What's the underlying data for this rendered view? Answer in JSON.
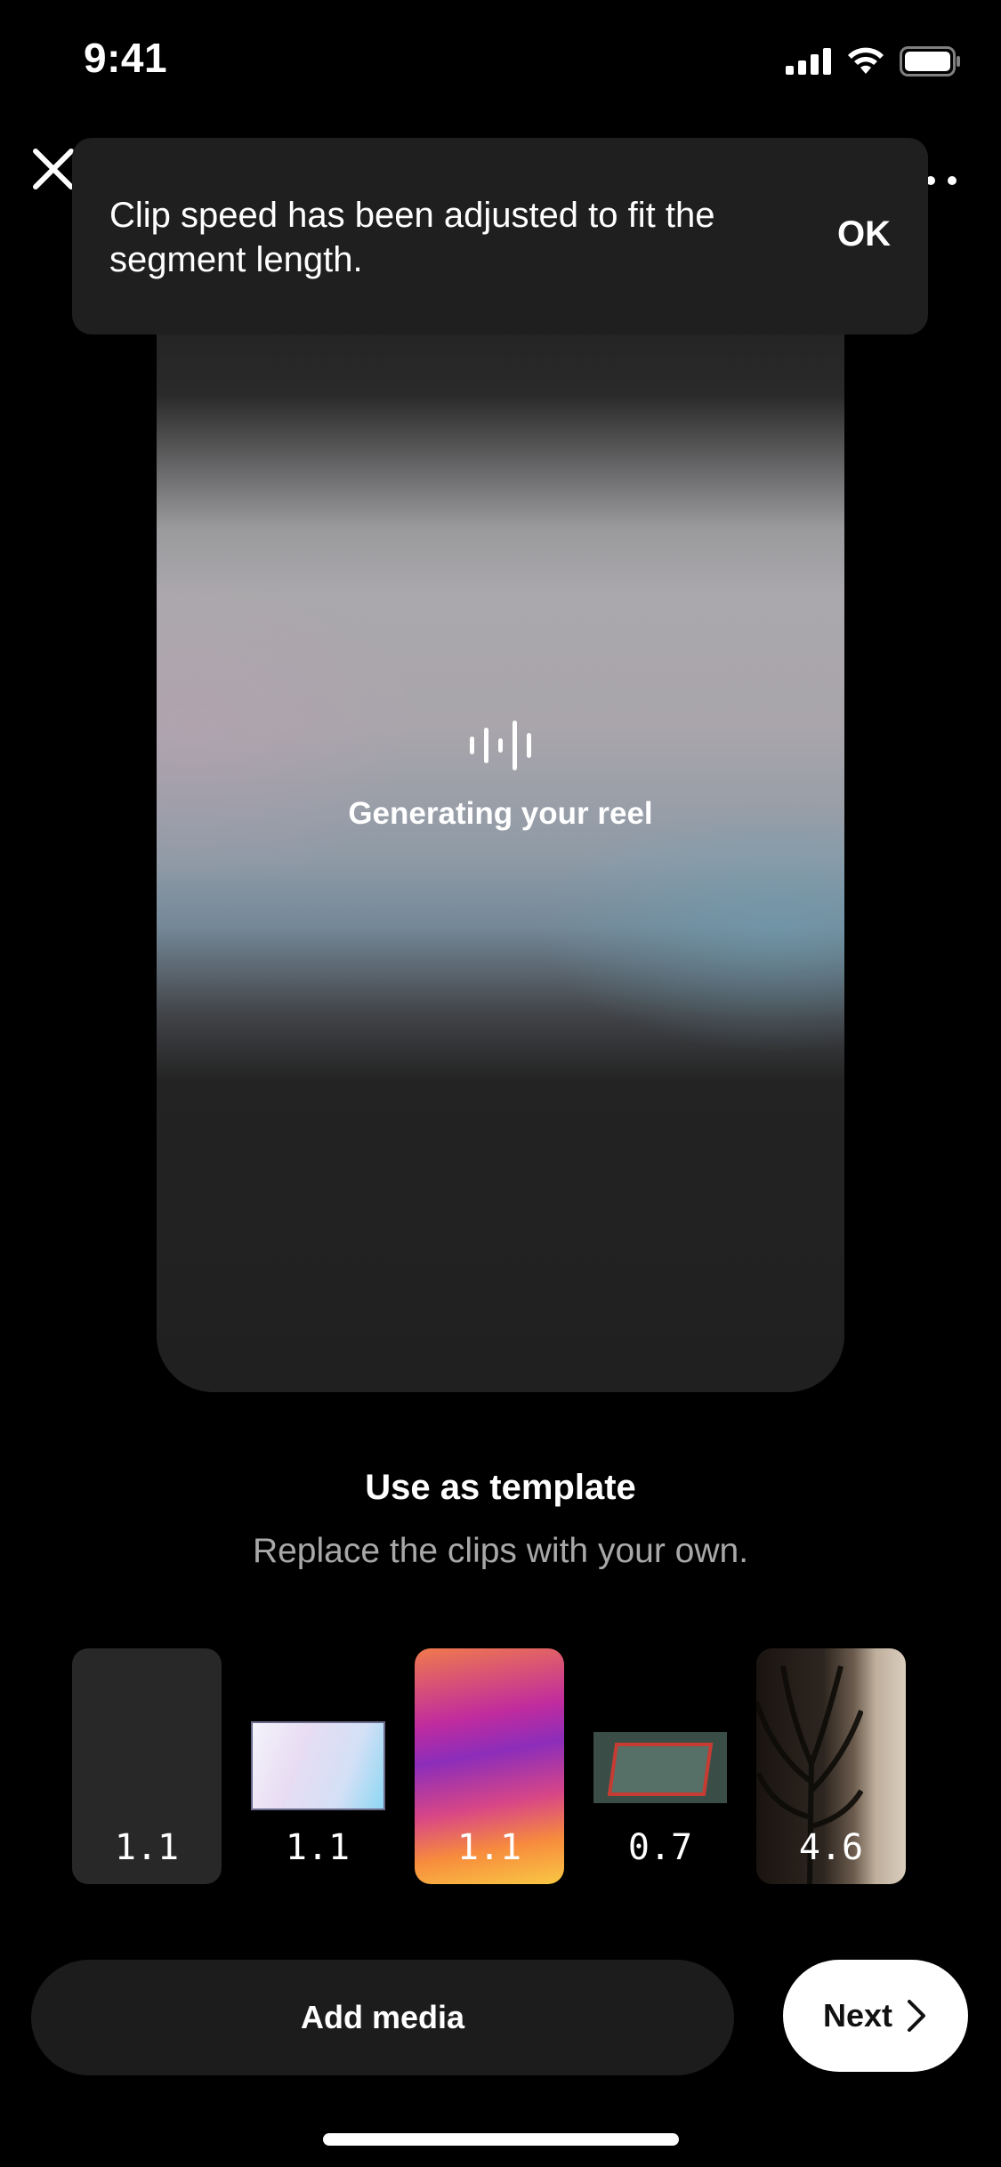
{
  "status_bar": {
    "time": "9:41"
  },
  "toast": {
    "message": "Clip speed has been adjusted to fit the segment length.",
    "action": "OK"
  },
  "preview": {
    "status_text": "Generating your reel"
  },
  "template": {
    "title": "Use as template",
    "subtitle": "Replace the clips with your own."
  },
  "clips": [
    {
      "duration": "1.1"
    },
    {
      "duration": "1.1"
    },
    {
      "duration": "1.1"
    },
    {
      "duration": "0.7"
    },
    {
      "duration": "4.6"
    }
  ],
  "actions": {
    "add_media": "Add media",
    "next": "Next"
  }
}
